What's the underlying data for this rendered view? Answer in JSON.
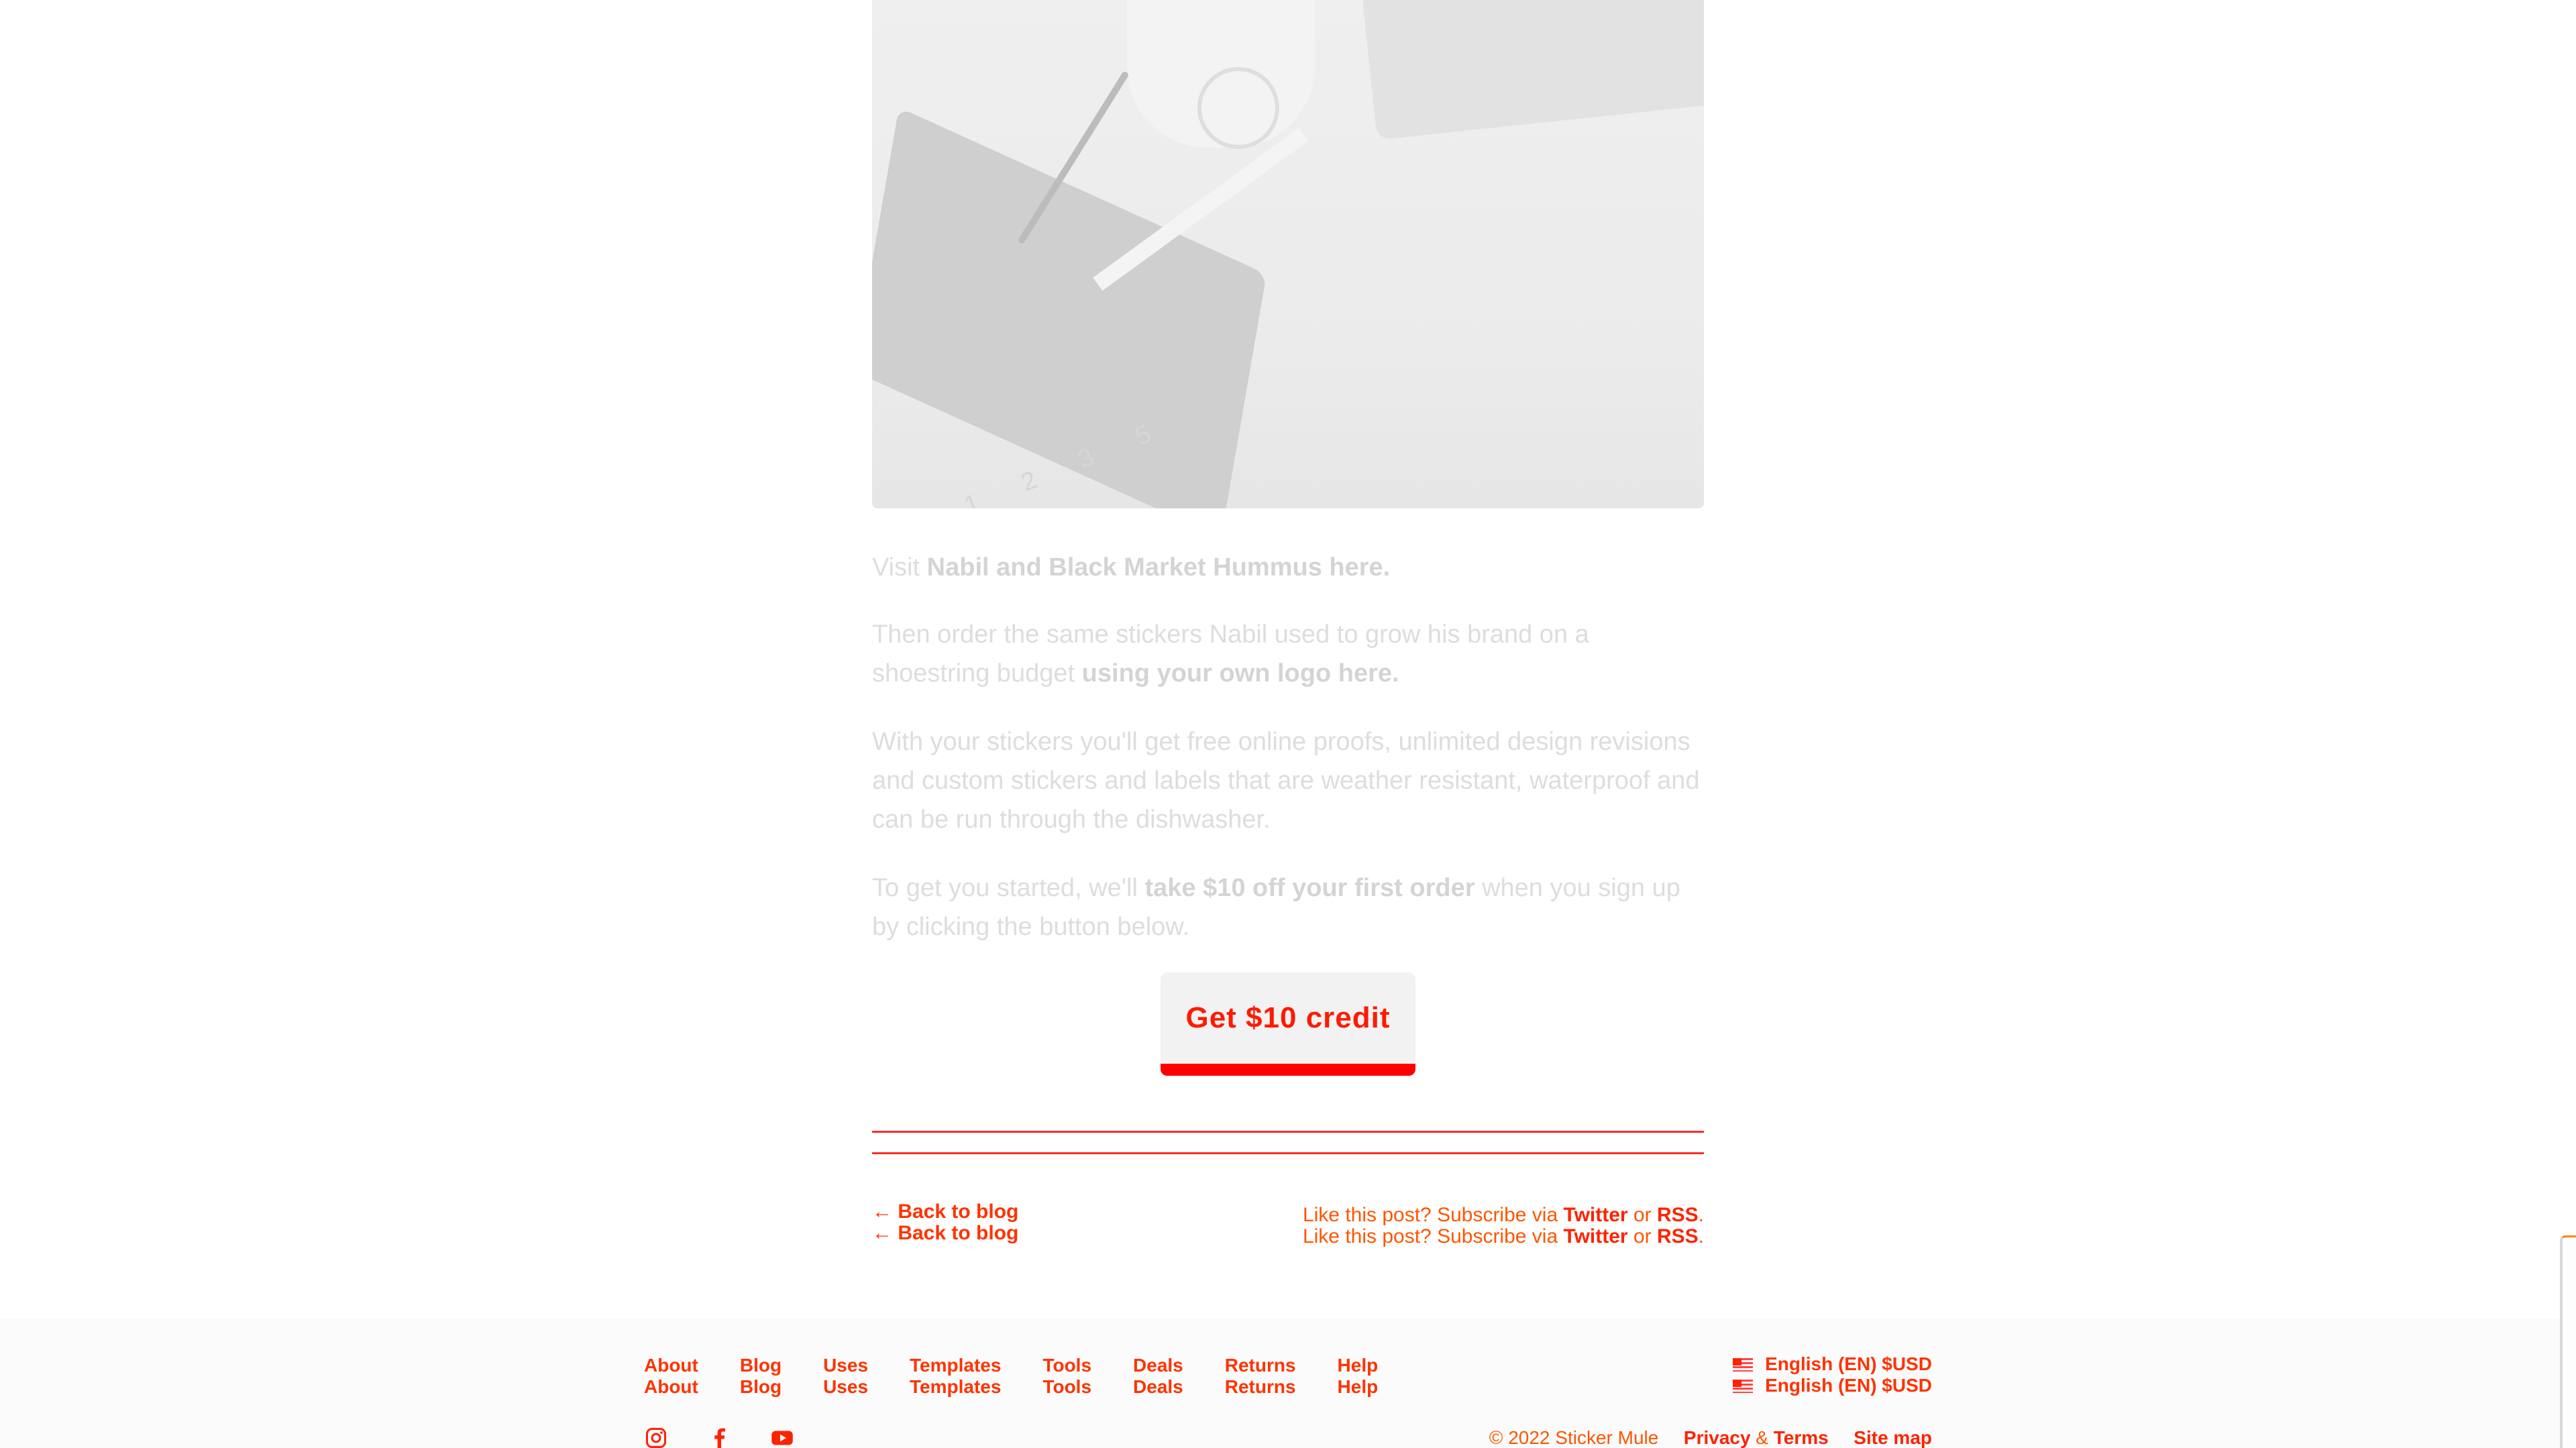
{
  "article": {
    "visit_prefix": "Visit ",
    "visit_link": "Nabil and Black Market Hummus here.",
    "order_text": "Then order the same stickers Nabil used to grow his brand on a shoestring budget ",
    "order_link": "using your own logo here.",
    "benefits_text": "With your stickers you'll get free online proofs, unlimited design revisions and custom stickers and labels that are weather resistant, waterproof and can be run through the dishwasher.",
    "promo_prefix": "To get you started, we'll ",
    "promo_bold": "take $10 off your first order",
    "promo_suffix": " when you sign up by clicking the button below.",
    "cta_label": "Get $10 credit",
    "hero_steps": "1 2 3 5"
  },
  "post_footer": {
    "back_label": "← Back to blog",
    "subscribe_prefix": "Like this post? Subscribe via ",
    "twitter": "Twitter",
    "or": " or ",
    "rss": "RSS",
    "period": "."
  },
  "footer": {
    "nav": [
      "About",
      "Blog",
      "Uses",
      "Templates",
      "Tools",
      "Deals",
      "Returns",
      "Help"
    ],
    "locale": "English (EN) $USD",
    "copyright": "© 2022 Sticker Mule",
    "privacy": "Privacy",
    "amp": " & ",
    "terms": "Terms",
    "sitemap": "Site map",
    "social_icons": [
      "instagram-icon",
      "facebook-icon",
      "youtube-icon"
    ]
  },
  "colors": {
    "accent": "#ff2200",
    "muted_text": "#dddddd"
  }
}
